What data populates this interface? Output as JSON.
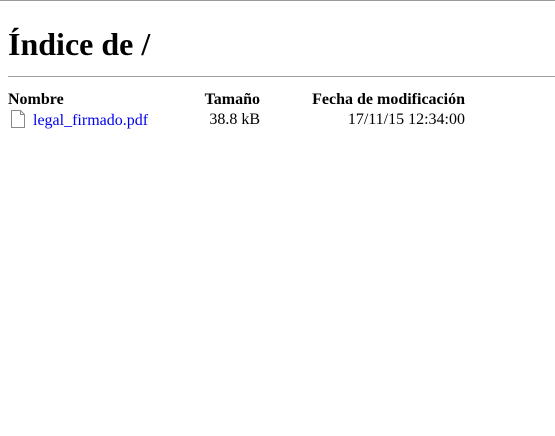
{
  "page": {
    "title": "Índice de /"
  },
  "table": {
    "headers": {
      "name": "Nombre",
      "size": "Tamaño",
      "date": "Fecha de modificación"
    },
    "rows": [
      {
        "icon": "file-icon",
        "name": "legal_firmado.pdf",
        "size": "38.8 kB",
        "date": "17/11/15 12:34:00"
      }
    ]
  }
}
